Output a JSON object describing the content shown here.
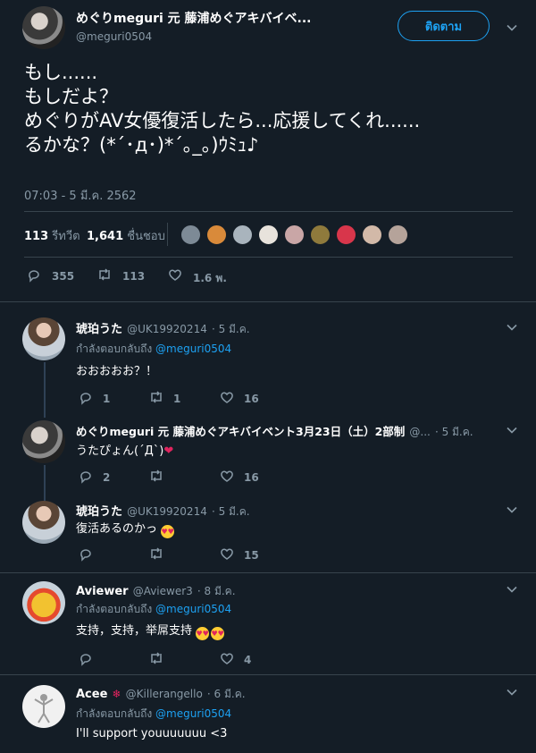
{
  "main_tweet": {
    "display_name": "めぐりmeguri 元 藤浦めぐアキバイベ...",
    "handle": "@meguri0504",
    "follow_label": "ติดตาม",
    "text_lines": [
      "もし......",
      "もしだよ？",
      "めぐりがAV女優復活したら...応援してくれ......",
      "るかな？(*´･д･)*´｡_｡)ｳﾐｭ♪"
    ],
    "timestamp": "07:03 - 5 มี.ค. 2562",
    "retweets_count": "113",
    "retweets_label": "รีทวีต",
    "likes_count": "1,641",
    "likes_label": "ชื่นชอบ",
    "replies": "355",
    "retweets": "113",
    "likes": "1.6 พ."
  },
  "replies": [
    {
      "display_name": "琥珀うた",
      "handle": "@UK19920214",
      "time": "· 5 มี.ค.",
      "reply_prefix": "กำลังตอบกลับถึง",
      "reply_to": "@meguri0504",
      "text": "おおおおお？！",
      "replies": "1",
      "retweets": "1",
      "likes": "16"
    },
    {
      "display_name": "めぐりmeguri 元 藤浦めぐアキバイベント3月23日（土）2部制",
      "handle": "@...",
      "time": "· 5 มี.ค.",
      "text": "うたぴょん(´Д`)",
      "replies": "2",
      "retweets": "",
      "likes": "16"
    },
    {
      "display_name": "琥珀うた",
      "handle": "@UK19920214",
      "time": "· 5 มี.ค.",
      "text": "復活あるのかっ",
      "replies": "",
      "retweets": "",
      "likes": "15"
    },
    {
      "display_name": "Aviewer",
      "handle": "@Aviewer3",
      "time": "· 8 มี.ค.",
      "reply_prefix": "กำลังตอบกลับถึง",
      "reply_to": "@meguri0504",
      "text": "支持，支持，举屌支持",
      "replies": "",
      "retweets": "",
      "likes": "4"
    },
    {
      "display_name": "Acee",
      "handle": "@Killerangello",
      "time": "· 6 มี.ค.",
      "reply_prefix": "กำลังตอบกลับถึง",
      "reply_to": "@meguri0504",
      "text": "I'll support youuuuuuu <3"
    }
  ],
  "colors": {
    "background": "#141d26",
    "accent": "#1da1f2",
    "muted": "#8899a6",
    "divider": "#38444d"
  },
  "icons": [
    "chevron-down-icon",
    "reply-icon",
    "retweet-icon",
    "like-icon",
    "heart-eyes-emoji",
    "red-heart-emoji",
    "maple-leaf-emoji"
  ]
}
